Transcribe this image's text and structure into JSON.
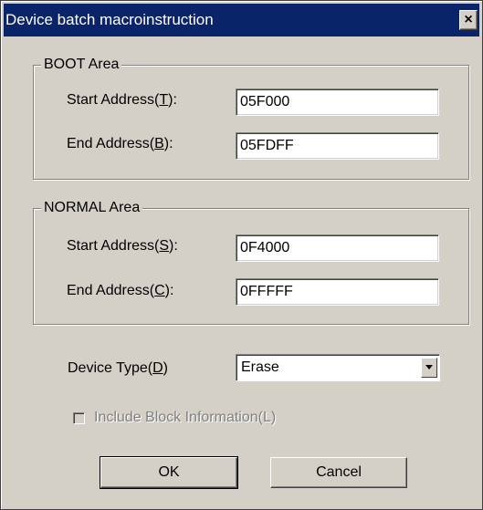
{
  "window": {
    "title": "Device batch macroinstruction",
    "close_glyph": "×"
  },
  "boot_area": {
    "label": "BOOT Area",
    "start_address": {
      "label_prefix": "Start Address(",
      "mnemonic": "T",
      "label_suffix": "):",
      "value": "05F000"
    },
    "end_address": {
      "label_prefix": "End Address(",
      "mnemonic": "B",
      "label_suffix": "):",
      "value": "05FDFF"
    }
  },
  "normal_area": {
    "label": "NORMAL Area",
    "start_address": {
      "label_prefix": "Start Address(",
      "mnemonic": "S",
      "label_suffix": "):",
      "value": "0F4000"
    },
    "end_address": {
      "label_prefix": "End Address(",
      "mnemonic": "C",
      "label_suffix": "):",
      "value": "0FFFFF"
    }
  },
  "device_type": {
    "label_prefix": "Device Type(",
    "mnemonic": "D",
    "label_suffix": ")",
    "selected": "Erase"
  },
  "include_block": {
    "label": "Include Block Information(L)",
    "checked": false,
    "enabled": false
  },
  "buttons": {
    "ok": "OK",
    "cancel": "Cancel"
  },
  "colors": {
    "title_bar": "#0a246a",
    "dialog_face": "#d4d0c8"
  },
  "icons": {
    "close": "close-icon",
    "dropdown": "chevron-down-icon"
  }
}
